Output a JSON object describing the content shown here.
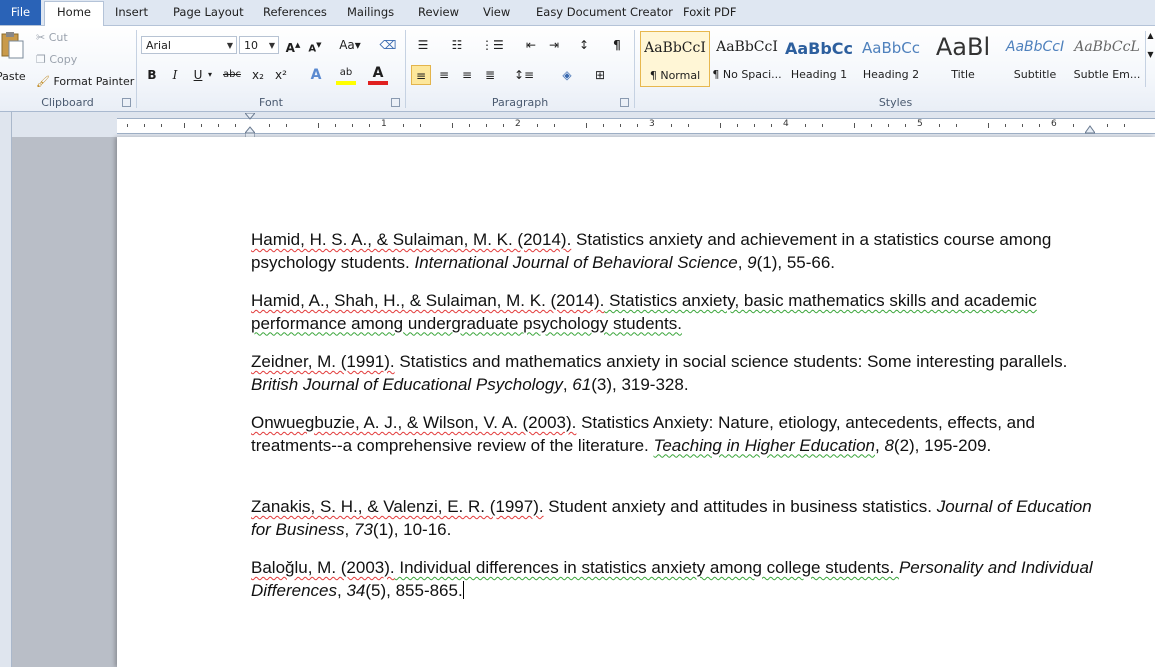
{
  "tabs": [
    "File",
    "Home",
    "Insert",
    "Page Layout",
    "References",
    "Mailings",
    "Review",
    "View",
    "Easy Document Creator",
    "Foxit PDF"
  ],
  "clipboard": {
    "paste_label": "Paste",
    "cut_label": "Cut",
    "copy_label": "Copy",
    "format_painter_label": "Format Painter",
    "group_label": "Clipboard"
  },
  "font": {
    "family": "Arial",
    "size": "10",
    "group_label": "Font",
    "grow": "A",
    "shrink": "A",
    "change_case": "Aa",
    "bold": "B",
    "italic": "I",
    "underline": "U",
    "strike": "abc",
    "subscript": "x₂",
    "superscript": "x²",
    "text_effects": "A",
    "highlight": "ab",
    "font_color": "A"
  },
  "paragraph": {
    "group_label": "Paragraph"
  },
  "styles": {
    "group_label": "Styles",
    "items": [
      {
        "sample": "AaBbCcI",
        "name": "¶ Normal"
      },
      {
        "sample": "AaBbCcI",
        "name": "¶ No Spaci..."
      },
      {
        "sample": "AaBbCc",
        "name": "Heading 1"
      },
      {
        "sample": "AaBbCc",
        "name": "Heading 2"
      },
      {
        "sample": "AaBl",
        "name": "Title"
      },
      {
        "sample": "AaBbCcI",
        "name": "Subtitle"
      },
      {
        "sample": "AaBbCcL",
        "name": "Subtle Em..."
      }
    ]
  },
  "ruler": {
    "numbers": [
      "1",
      "2",
      "3",
      "4",
      "5",
      "6"
    ]
  },
  "colors": {
    "file_tab": "#2a63b7",
    "spell": "#e23a3a",
    "grammar": "#3aa53a",
    "font_color": "#e02020",
    "highlight": "#ffff00"
  },
  "references": [
    {
      "authors": "Hamid, H. S. A., & Sulaiman, M. K. (2014).",
      "title": " Statistics anxiety and achievement in a statistics course among psychology students. ",
      "journal": "International Journal of Behavioral Science",
      "volume": "9",
      "rest": "(1), 55-66."
    },
    {
      "authors": "Hamid, A., Shah, H., & Sulaiman, M. K. (2014).",
      "title": " Statistics anxiety, basic mathematics skills and academic performance among undergraduate psychology students."
    },
    {
      "authors": "Zeidner, M. (1991).",
      "title": " Statistics and mathematics anxiety in social science students: Some interesting parallels. ",
      "journal": "British Journal of Educational Psychology",
      "volume": "61",
      "rest": "(3), 319-328."
    },
    {
      "authors": "Onwuegbuzie, A. J., & Wilson, V. A. (2003).",
      "title": " Statistics Anxiety: Nature, etiology, antecedents, effects, and treatments--a comprehensive review of the literature. ",
      "journal": "Teaching in Higher Education",
      "volume": "8",
      "rest": "(2), 195-209."
    },
    {
      "authors": "Zanakis, S. H., & Valenzi, E. R. (1997).",
      "title": " Student anxiety and attitudes in business statistics. ",
      "journal": "Journal of Education for Business",
      "volume": "73",
      "rest": "(1), 10-16."
    },
    {
      "authors": "Baloğlu, M. (2003).",
      "title": " Individual differences in statistics anxiety among college students. ",
      "journal": "Personality and Individual Differences",
      "volume": "34",
      "rest": "(5), 855-865."
    }
  ]
}
